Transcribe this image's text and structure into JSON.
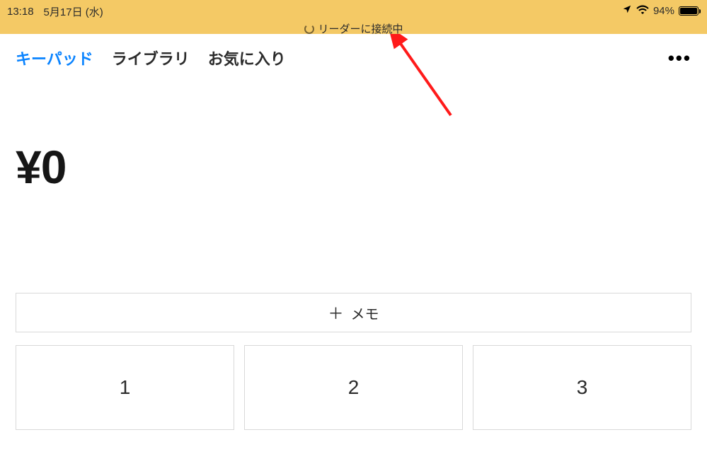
{
  "statusbar": {
    "time": "13:18",
    "date": "5月17日 (水)",
    "connecting_text": "リーダーに接続中",
    "battery_pct": "94%"
  },
  "tabs": {
    "keypad": "キーパッド",
    "library": "ライブラリ",
    "favorites": "お気に入り"
  },
  "amount": "¥0",
  "memo_label": "メモ",
  "keypad": {
    "k1": "1",
    "k2": "2",
    "k3": "3"
  }
}
